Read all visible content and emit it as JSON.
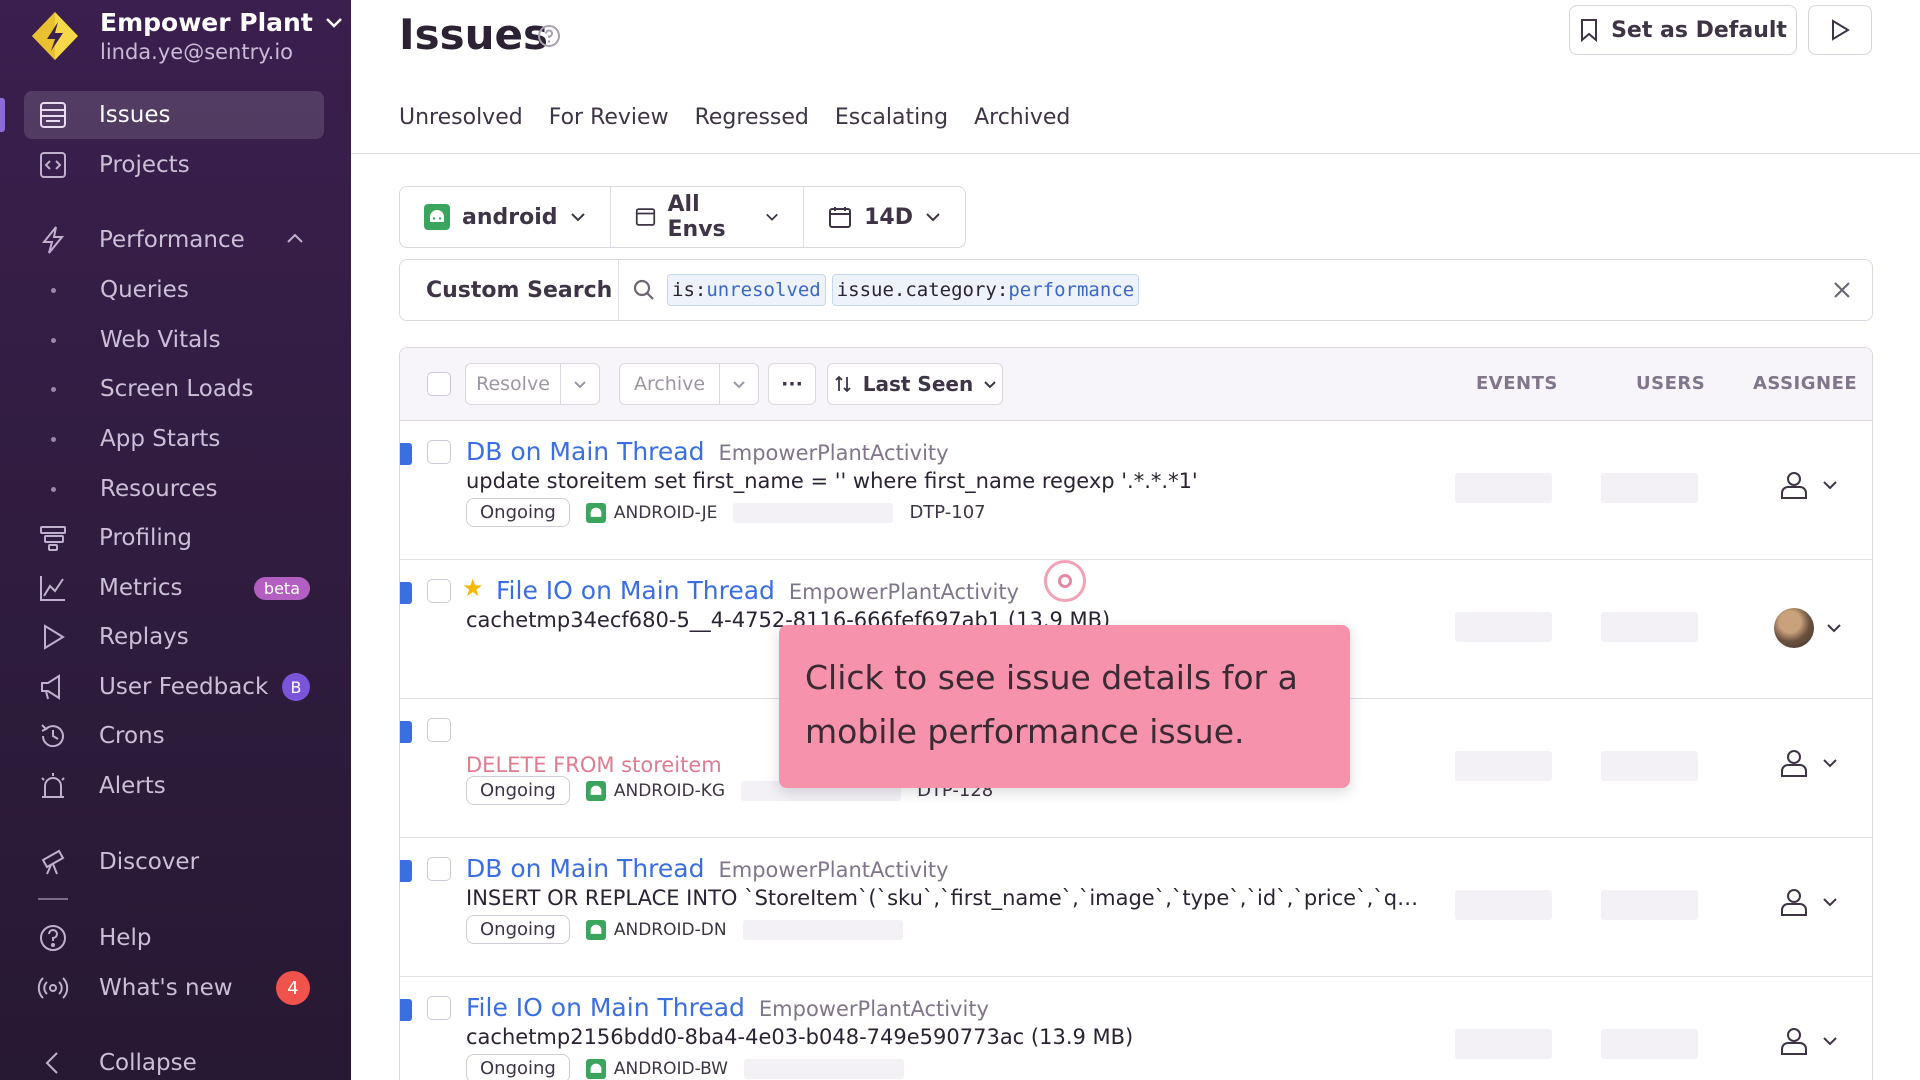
{
  "org": {
    "name": "Empower Plant",
    "email": "linda.ye@sentry.io"
  },
  "nav": {
    "issues": "Issues",
    "projects": "Projects",
    "performance": "Performance",
    "perf_sub": [
      "Queries",
      "Web Vitals",
      "Screen Loads",
      "App Starts",
      "Resources"
    ],
    "profiling": "Profiling",
    "metrics": "Metrics",
    "metrics_badge": "beta",
    "replays": "Replays",
    "user_feedback": "User Feedback",
    "user_feedback_badge": "B",
    "crons": "Crons",
    "alerts": "Alerts",
    "discover": "Discover",
    "help": "Help",
    "whats_new": "What's new",
    "whats_new_badge": "4",
    "collapse": "Collapse"
  },
  "header": {
    "title": "Issues",
    "set_default": "Set as Default",
    "tabs": [
      "Unresolved",
      "For Review",
      "Regressed",
      "Escalating",
      "Archived"
    ]
  },
  "filters": {
    "project": "android",
    "env": "All Envs",
    "date": "14D"
  },
  "search": {
    "label": "Custom Search",
    "token1_key": "is:",
    "token1_val": "unresolved",
    "token2_key": "issue.category:",
    "token2_val": "performance"
  },
  "table": {
    "resolve": "Resolve",
    "archive": "Archive",
    "more": "···",
    "sort": "Last Seen",
    "col_events": "EVENTS",
    "col_users": "USERS",
    "col_assignee": "ASSIGNEE"
  },
  "rows": [
    {
      "title": "DB on Main Thread",
      "culprit": "EmpowerPlantActivity",
      "message": "update storeitem set first_name = '' where first_name regexp '.*.*.*1'",
      "status": "Ongoing",
      "short_id": "ANDROID-JE",
      "ticket": "DTP-107"
    },
    {
      "title": "File IO on Main Thread",
      "culprit": "EmpowerPlantActivity",
      "message": "cachetmp34ecf680-5__4-4752-8116-666fef697ab1 (13.9 MB)",
      "status": "",
      "short_id": "",
      "ticket": ""
    },
    {
      "title": "",
      "culprit": "",
      "message": "DELETE FROM storeitem",
      "status": "Ongoing",
      "short_id": "ANDROID-KG",
      "ticket": "DTP-128"
    },
    {
      "title": "DB on Main Thread",
      "culprit": "EmpowerPlantActivity",
      "message": "INSERT OR REPLACE INTO `StoreItem`(`sku`,`first_name`,`image`,`type`,`id`,`price`,`quanti...",
      "status": "Ongoing",
      "short_id": "ANDROID-DN",
      "ticket": ""
    },
    {
      "title": "File IO on Main Thread",
      "culprit": "EmpowerPlantActivity",
      "message": "cachetmp2156bdd0-8ba4-4e03-b048-749e590773ac (13.9 MB)",
      "status": "Ongoing",
      "short_id": "ANDROID-BW",
      "ticket": ""
    }
  ],
  "tooltip": {
    "text": "Click to see issue details for a mobile performance issue."
  },
  "colors": {
    "sidebar": "#3b1f4f",
    "link": "#3b6fe0",
    "tooltip": "#f792ac",
    "badge_beta": "#b35fc2",
    "badge_count": "#f0524c"
  }
}
